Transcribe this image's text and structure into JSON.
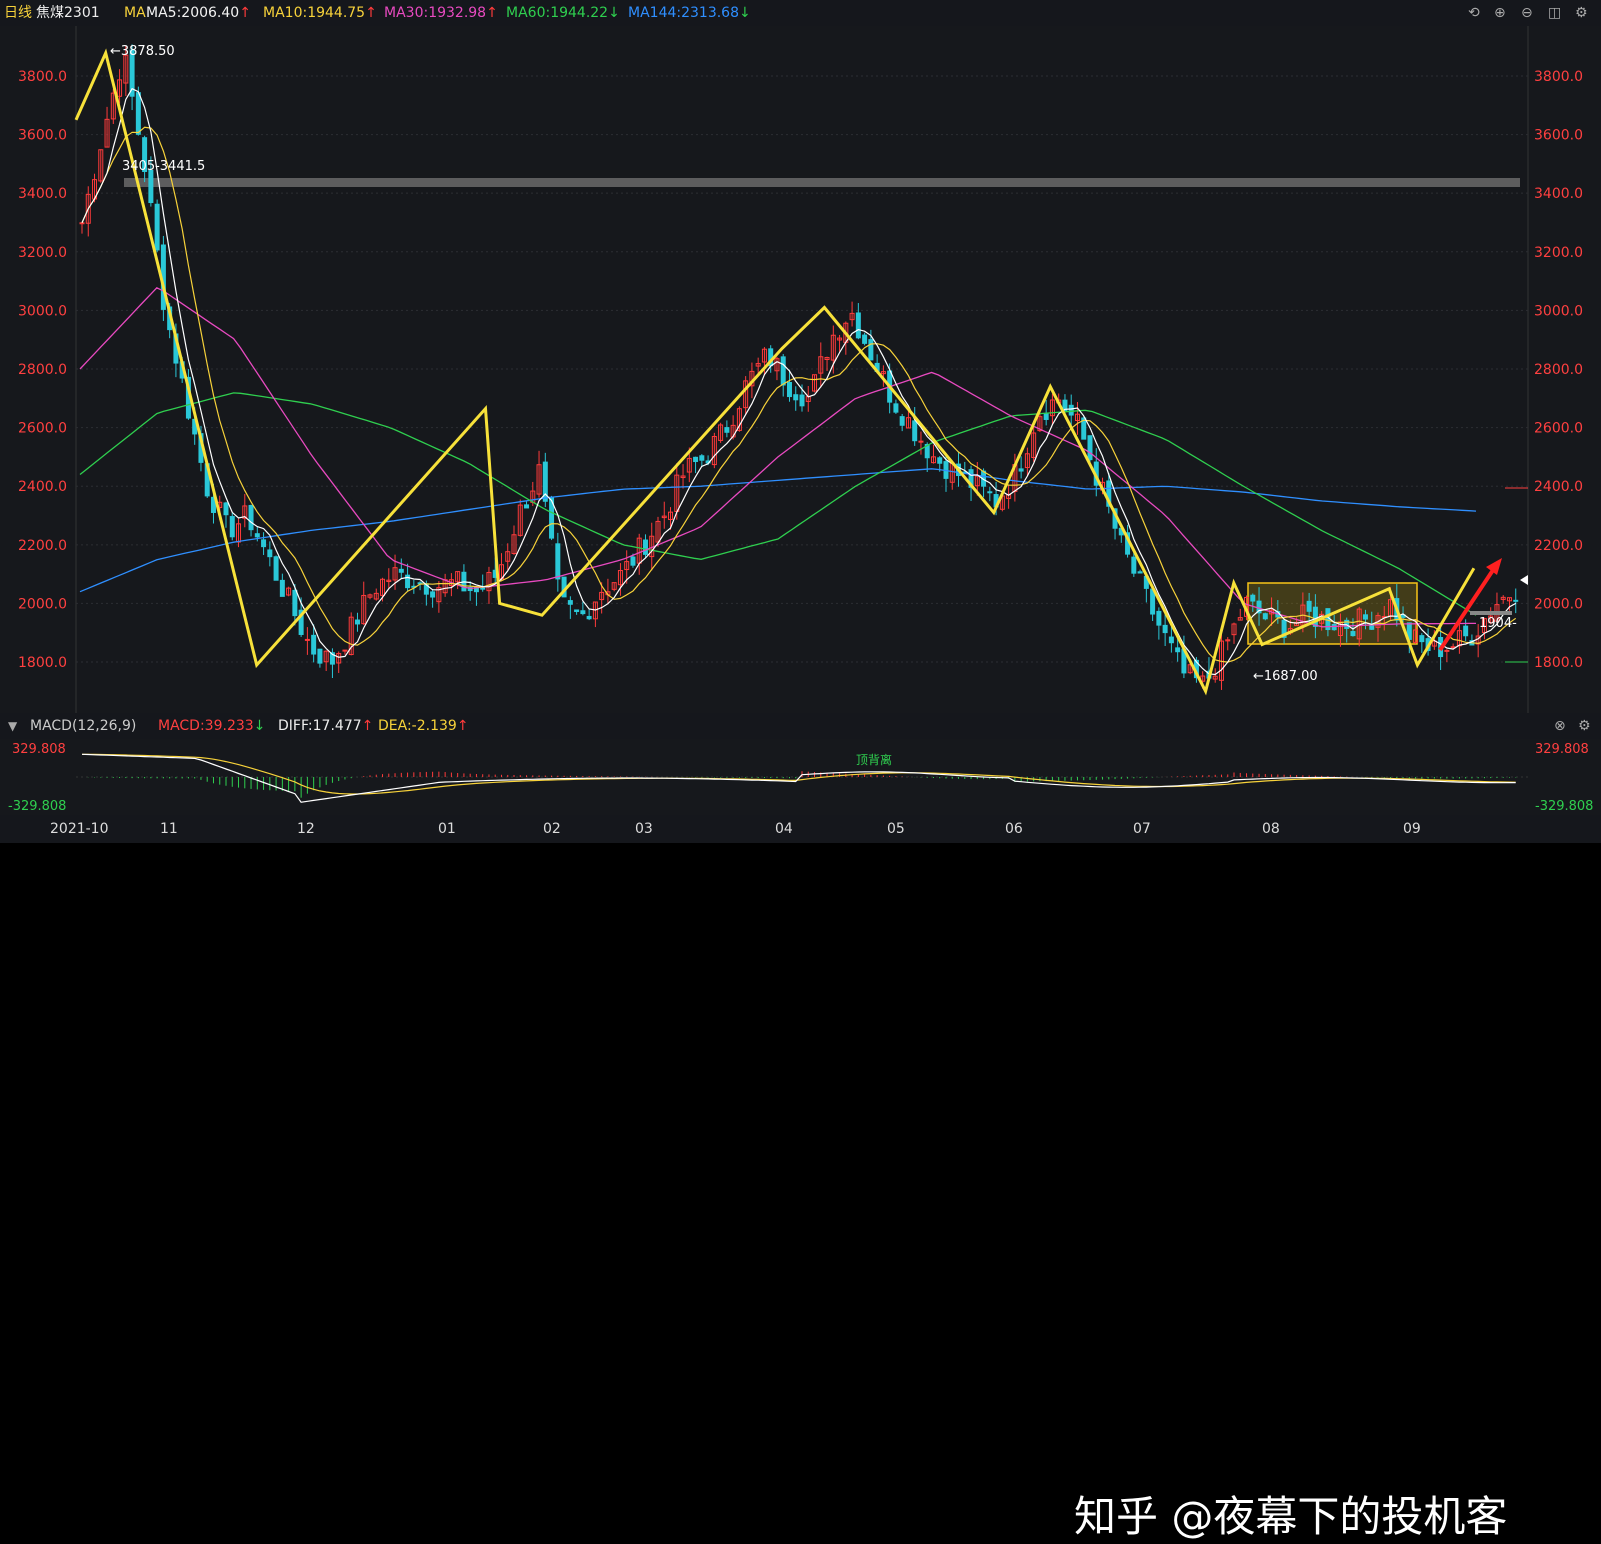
{
  "header": {
    "period": "日线",
    "symbol": "焦煤2301",
    "ma_prefix": "MA",
    "ma": [
      {
        "label": "MA5:2006.40",
        "arrow": "↑",
        "color": "#f3f3f3",
        "arrow_color": "#ff3b3b"
      },
      {
        "label": "MA10:1944.75",
        "arrow": "↑",
        "color": "#f7d23a",
        "arrow_color": "#ff3b3b"
      },
      {
        "label": "MA30:1932.98",
        "arrow": "↑",
        "color": "#e84ac0",
        "arrow_color": "#ff3b3b"
      },
      {
        "label": "MA60:1944.22",
        "arrow": "↓",
        "color": "#2fcf4f",
        "arrow_color": "#2fcf4f"
      },
      {
        "label": "MA144:2313.68",
        "arrow": "↓",
        "color": "#2f8fff",
        "arrow_color": "#2fcf4f"
      }
    ],
    "icons": [
      "undo-icon",
      "zoom-in-icon",
      "zoom-out-icon",
      "window-icon",
      "settings-icon"
    ]
  },
  "price_axis": {
    "ticks": [
      "3800.0",
      "3600.0",
      "3400.0",
      "3200.0",
      "3000.0",
      "2800.0",
      "2600.0",
      "2400.0",
      "2200.0",
      "2000.0",
      "1800.0"
    ],
    "tick_values": [
      3800,
      3600,
      3400,
      3200,
      3000,
      2800,
      2600,
      2400,
      2200,
      2000,
      1800
    ],
    "color": "#ff4040"
  },
  "annotations": {
    "high": "←3878.50",
    "low": "←1687.00",
    "zone": "3405-3441.5",
    "recent": "1904-"
  },
  "macd": {
    "title": "MACD(12,26,9)",
    "macd": "MACD:39.233",
    "macd_arrow": "↓",
    "diff": "DIFF:17.477",
    "diff_arrow": "↑",
    "dea": "DEA:-2.139",
    "dea_arrow": "↑",
    "axis_top": "329.808",
    "axis_bottom": "-329.808",
    "label_in_chart": "顶背离"
  },
  "x_axis": [
    "2021-10",
    "11",
    "12",
    "01",
    "02",
    "03",
    "04",
    "05",
    "06",
    "07",
    "08",
    "09"
  ],
  "watermark": "知乎 @夜幕下的投机客",
  "chart_data": {
    "type": "candlestick",
    "ylim": [
      1650,
      3950
    ],
    "x_labels": [
      "2021-10",
      "11",
      "12",
      "01",
      "02",
      "03",
      "04",
      "05",
      "06",
      "07",
      "08",
      "09"
    ],
    "zigzag": [
      3650,
      3878.5,
      1790,
      2665,
      2000,
      1960,
      2870,
      3010,
      2310,
      2740,
      1700,
      2070,
      1860,
      2050,
      1790,
      2120
    ],
    "zigzag_pos": [
      0,
      0.021,
      0.128,
      0.29,
      0.3,
      0.33,
      0.5,
      0.53,
      0.65,
      0.69,
      0.8,
      0.82,
      0.84,
      0.93,
      0.95,
      0.99
    ],
    "closes_path": [
      3300,
      3600,
      3878,
      3500,
      3000,
      2700,
      2400,
      2250,
      2300,
      2150,
      2000,
      1850,
      1800,
      1920,
      2050,
      2100,
      2080,
      2060,
      2070,
      2040,
      2100,
      2300,
      2450,
      2000,
      1950,
      2050,
      2100,
      2200,
      2300,
      2450,
      2500,
      2600,
      2750,
      2850,
      2750,
      2700,
      2900,
      3000,
      2850,
      2700,
      2600,
      2500,
      2450,
      2400,
      2350,
      2450,
      2650,
      2700,
      2600,
      2400,
      2200,
      2050,
      1900,
      1760,
      1720,
      1850,
      2000,
      1950,
      1920,
      1960,
      1940,
      1930,
      1950,
      2000,
      1880,
      1840,
      1860,
      1900,
      2000,
      2050
    ],
    "ma144": [
      2040,
      2150,
      2210,
      2250,
      2280,
      2320,
      2360,
      2390,
      2400,
      2420,
      2440,
      2460,
      2420,
      2390,
      2400,
      2380,
      2350,
      2330,
      2315
    ],
    "ma60": [
      2440,
      2650,
      2720,
      2680,
      2600,
      2480,
      2320,
      2200,
      2150,
      2220,
      2400,
      2550,
      2640,
      2660,
      2560,
      2400,
      2250,
      2120,
      1960
    ],
    "ma30": [
      2800,
      3080,
      2900,
      2500,
      2150,
      2050,
      2080,
      2150,
      2260,
      2500,
      2700,
      2790,
      2640,
      2520,
      2300,
      2000,
      1920,
      1930,
      1932
    ],
    "macd_levels": {
      "top": 329.808,
      "bottom": -329.808
    }
  },
  "colors": {
    "up": "#ff3b3b",
    "down": "#2ac8d8",
    "zigzag": "#f7e13a",
    "ma5": "#ffffff",
    "ma10": "#f7d23a",
    "ma30": "#e84ac0",
    "ma60": "#2fcf4f",
    "ma144": "#2f8fff",
    "arrow": "#ff2020"
  }
}
